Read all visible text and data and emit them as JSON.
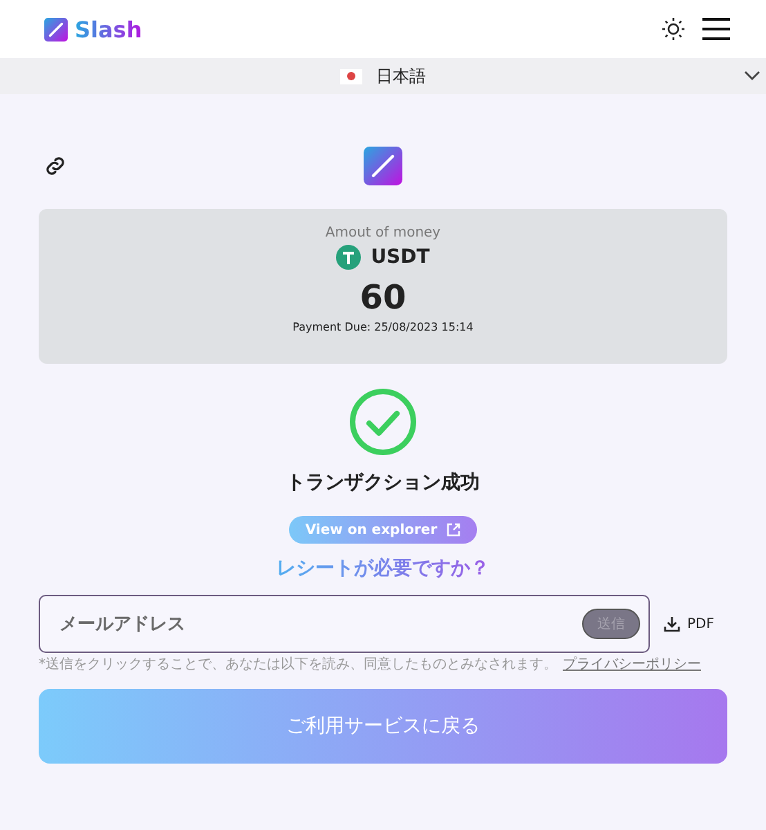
{
  "header": {
    "brand": "Slash"
  },
  "language": {
    "label": "日本語"
  },
  "payment": {
    "caption": "Amout of money",
    "currency": "USDT",
    "amount": "60",
    "due": "Payment Due: 25/08/2023 15:14"
  },
  "status": {
    "title": "トランザクション成功",
    "explorer_link": "View on explorer"
  },
  "receipt": {
    "question": "レシートが必要ですか？",
    "email_placeholder": "メールアドレス",
    "send_button": {
      "label": "送信",
      "disabled": true
    },
    "pdf_button": "PDF",
    "note": "*送信をクリックすることで、あなたは以下を読み、同意したものとみなされます。",
    "policy_link": "プライバシーポリシー"
  },
  "return_button": "ご利用サービスに戻る"
}
